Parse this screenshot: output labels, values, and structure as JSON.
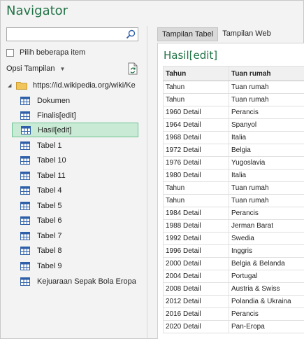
{
  "app": {
    "title": "Navigator"
  },
  "search": {
    "placeholder": "",
    "value": ""
  },
  "multi_select": {
    "label": "Pilih beberapa item",
    "checked": false
  },
  "display_options": {
    "label": "Opsi Tampilan"
  },
  "tree": {
    "root": {
      "label": "https://id.wikipedia.org/wiki/Ke"
    },
    "items": [
      {
        "label": "Dokumen"
      },
      {
        "label": "Finalis[edit]"
      },
      {
        "label": "Hasil[edit]",
        "selected": true
      },
      {
        "label": "Tabel 1"
      },
      {
        "label": "Tabel 10"
      },
      {
        "label": "Tabel 11"
      },
      {
        "label": "Tabel 4"
      },
      {
        "label": "Tabel 5"
      },
      {
        "label": "Tabel 6"
      },
      {
        "label": "Tabel 7"
      },
      {
        "label": "Tabel 8"
      },
      {
        "label": "Tabel 9"
      },
      {
        "label": "Kejuaraan Sepak Bola Eropa U..."
      }
    ]
  },
  "tabs": [
    {
      "label": "Tampilan Tabel",
      "active": true
    },
    {
      "label": "Tampilan Web",
      "active": false
    }
  ],
  "preview": {
    "title": "Hasil[edit]",
    "columns": [
      "Tahun",
      "Tuan rumah"
    ],
    "rows": [
      [
        "Tahun",
        "Tuan rumah"
      ],
      [
        "Tahun",
        "Tuan rumah"
      ],
      [
        "1960 Detail",
        "Perancis"
      ],
      [
        "1964 Detail",
        "Spanyol"
      ],
      [
        "1968 Detail",
        "Italia"
      ],
      [
        "1972 Detail",
        "Belgia"
      ],
      [
        "1976 Detail",
        "Yugoslavia"
      ],
      [
        "1980 Detail",
        "Italia"
      ],
      [
        "Tahun",
        "Tuan rumah"
      ],
      [
        "Tahun",
        "Tuan rumah"
      ],
      [
        "1984 Detail",
        "Perancis"
      ],
      [
        "1988 Detail",
        "Jerman Barat"
      ],
      [
        "1992 Detail",
        "Swedia"
      ],
      [
        "1996 Detail",
        "Inggris"
      ],
      [
        "2000 Detail",
        "Belgia & Belanda"
      ],
      [
        "2004 Detail",
        "Portugal"
      ],
      [
        "2008 Detail",
        "Austria & Swiss"
      ],
      [
        "2012 Detail",
        "Polandia & Ukraina"
      ],
      [
        "2016 Detail",
        "Perancis"
      ],
      [
        "2020 Detail",
        "Pan-Eropa"
      ]
    ]
  },
  "colors": {
    "accent": "#217346",
    "selected_bg": "#c9ebd5",
    "selected_border": "#6cc291",
    "table_icon": "#2e5fa8"
  }
}
